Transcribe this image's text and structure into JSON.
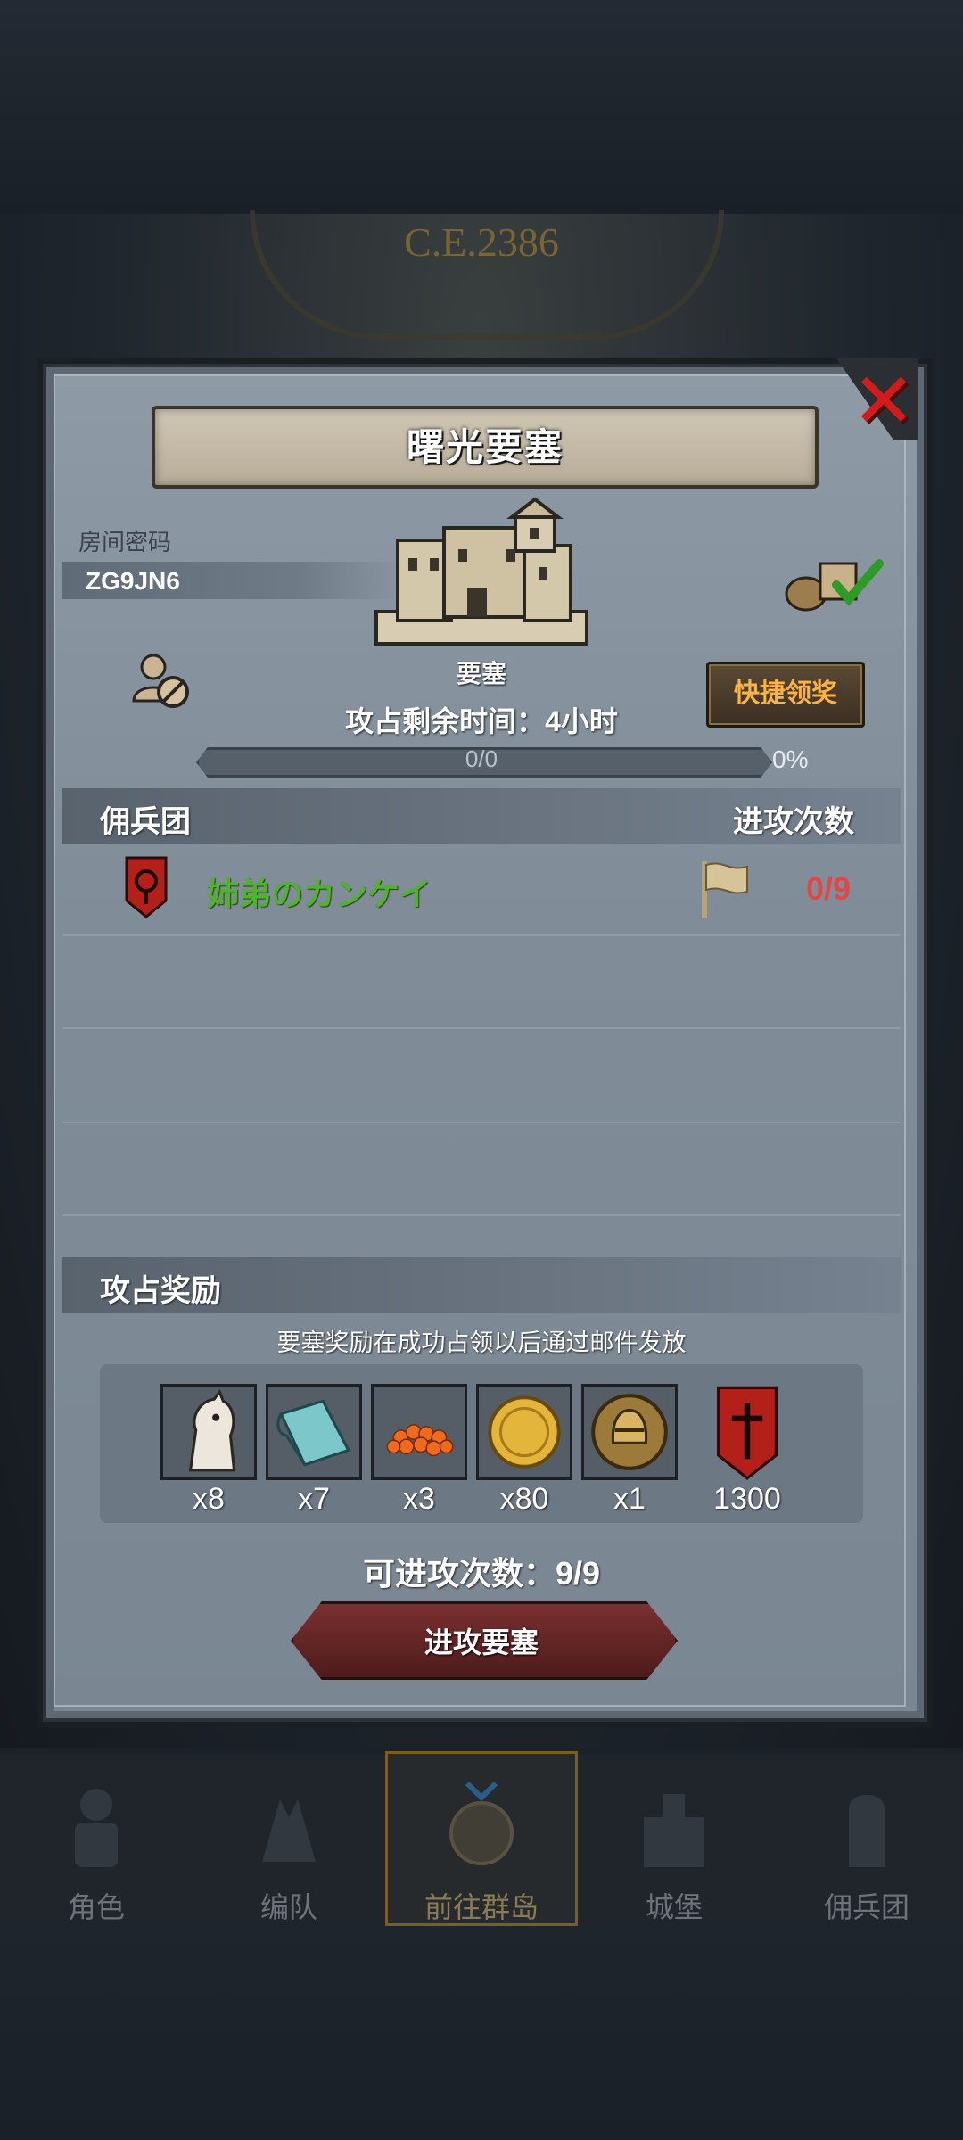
{
  "header": {
    "year": "C.E.2386"
  },
  "dialog": {
    "title": "曙光要塞",
    "room_password_label": "房间密码",
    "room_password_value": "ZG9JN6",
    "fortress_label": "要塞",
    "quick_claim_label": "快捷领奖",
    "remaining_time": "攻占剩余时间：4小时",
    "progress": {
      "text": "0/0",
      "percent_text": "0%",
      "fraction": 0
    },
    "mercenary_section": {
      "title": "佣兵团",
      "count_header": "进攻次数",
      "rows": [
        {
          "name": "姉弟のカンケイ",
          "attacks": "0/9"
        }
      ]
    },
    "reward_section": {
      "title": "攻占奖励",
      "note": "要塞奖励在成功占领以后通过邮件发放",
      "items": [
        {
          "icon": "horse-icon",
          "qty": "x8"
        },
        {
          "icon": "cloth-icon",
          "qty": "x7"
        },
        {
          "icon": "roe-icon",
          "qty": "x3"
        },
        {
          "icon": "gold-coin-icon",
          "qty": "x80"
        },
        {
          "icon": "knight-medal-icon",
          "qty": "x1"
        },
        {
          "icon": "guild-banner-icon",
          "qty": "1300"
        }
      ]
    },
    "attacks_available": "可进攻次数：9/9",
    "attack_button_label": "进攻要塞"
  },
  "bottom_nav": [
    {
      "label": "角色",
      "icon": "character-icon",
      "active": false
    },
    {
      "label": "编队",
      "icon": "formation-icon",
      "active": false
    },
    {
      "label": "前往群岛",
      "icon": "islands-icon",
      "active": true
    },
    {
      "label": "城堡",
      "icon": "castle-icon",
      "active": false
    },
    {
      "label": "佣兵团",
      "icon": "mercenary-icon",
      "active": false
    }
  ],
  "colors": {
    "guild_name": "#4fb32f",
    "attack_count": "#e04848",
    "quick_claim_text": "#ffb347",
    "close_x": "#d11c1c"
  }
}
